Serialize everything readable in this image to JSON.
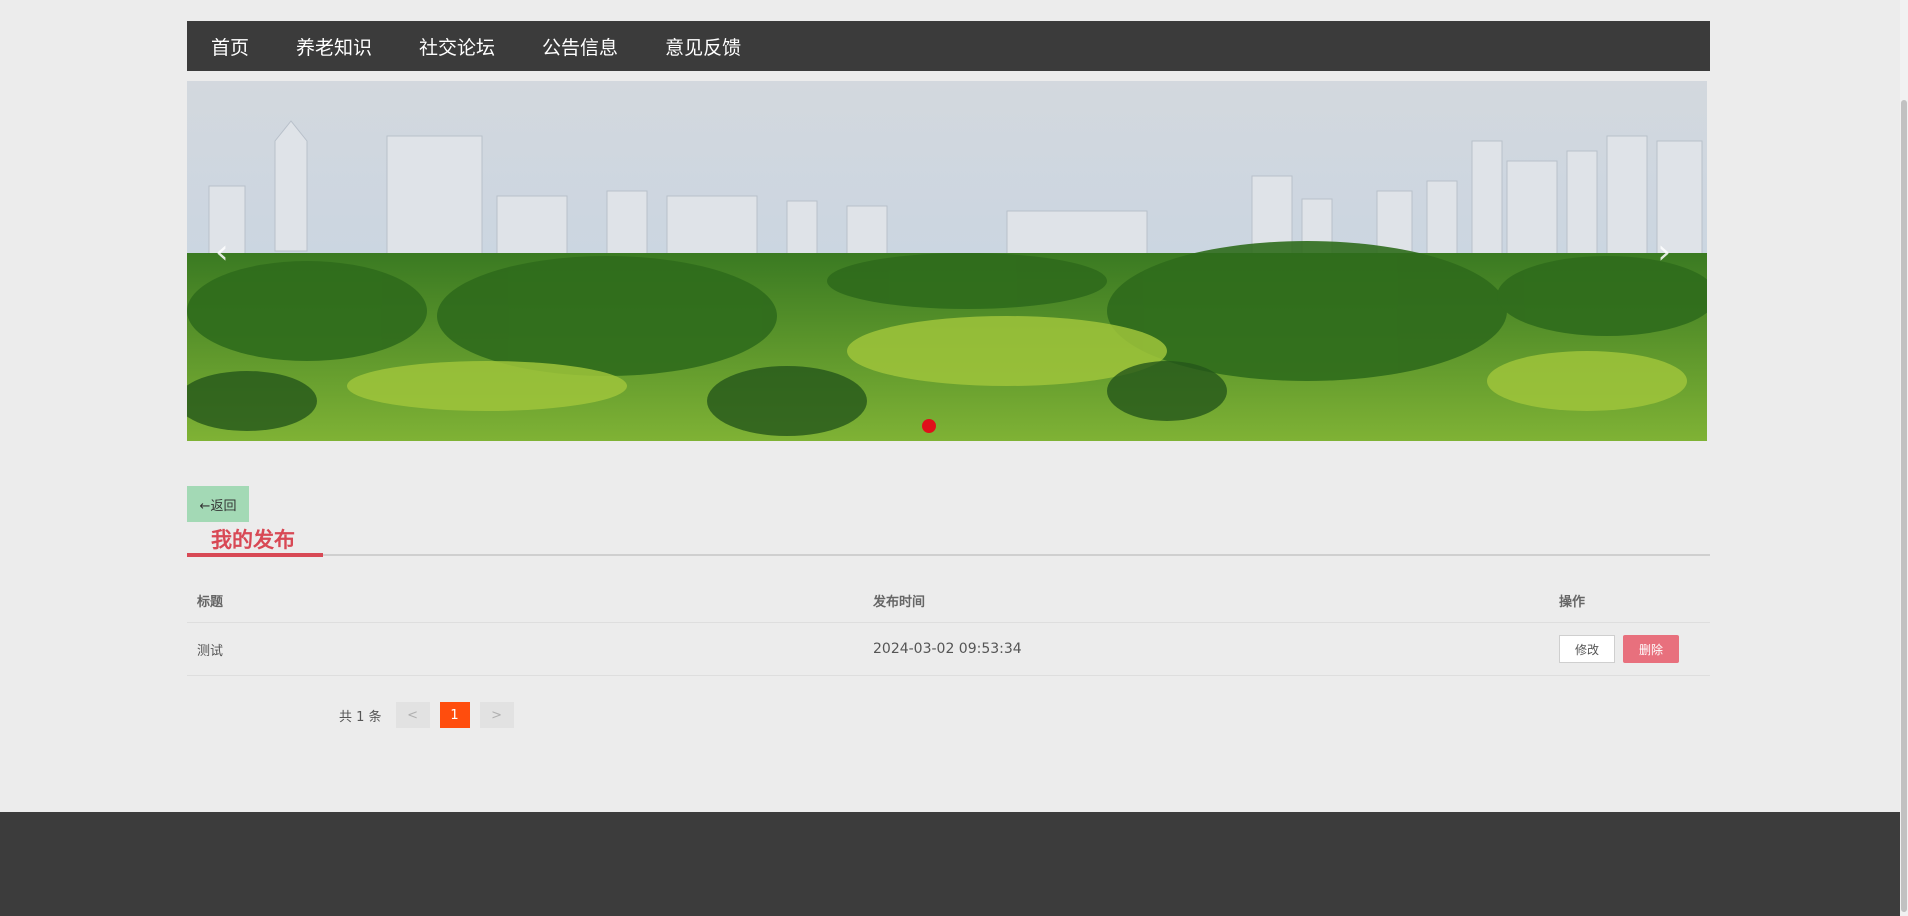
{
  "nav": {
    "items": [
      "首页",
      "养老知识",
      "社交论坛",
      "公告信息",
      "意见反馈"
    ]
  },
  "banner": {
    "prev_symbol": "‹",
    "next_symbol": "›",
    "active_slide": 1,
    "slide_count": 1
  },
  "back_button": {
    "label": "←返回"
  },
  "section": {
    "title": "我的发布"
  },
  "table": {
    "headers": [
      "标题",
      "发布时间",
      "操作"
    ],
    "rows": [
      {
        "title": "测试",
        "time": "2024-03-02 09:53:34",
        "edit_label": "修改",
        "delete_label": "删除"
      }
    ]
  },
  "pagination": {
    "total_text": "共 1 条",
    "prev": "<",
    "current": "1",
    "next": ">"
  },
  "colors": {
    "nav_bg": "#3b3b3b",
    "accent": "#d84955",
    "back_button_bg": "#a3d9b5",
    "delete_bg": "#e8707d",
    "page_active": "#ff4d0d",
    "footer_bg": "#3c3c3c"
  }
}
